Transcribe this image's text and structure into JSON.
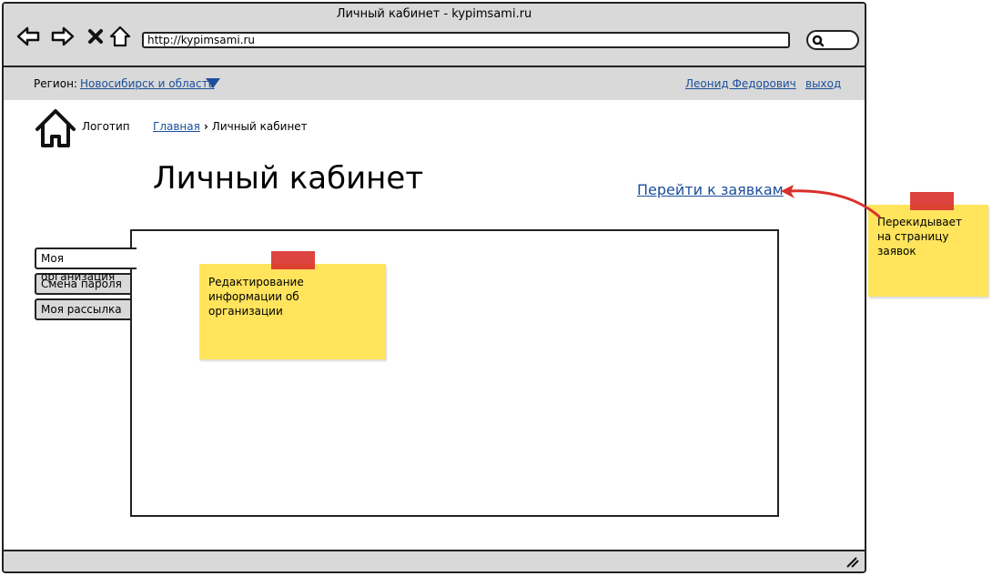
{
  "window": {
    "title": "Личный кабинет - kypimsami.ru",
    "url": "http://kypimsami.ru"
  },
  "region": {
    "label": "Регион:",
    "value": "Новосибирск и область"
  },
  "user": {
    "name": "Леонид Федорович",
    "logout": "выход"
  },
  "logo": {
    "text": "Логотип"
  },
  "breadcrumb": {
    "home": "Главная",
    "current": "Личный кабинет"
  },
  "page": {
    "title": "Личный кабинет",
    "orders_link": "Перейти к заявкам"
  },
  "tabs": [
    {
      "label": "Моя организация",
      "active": true
    },
    {
      "label": "Смена пароля",
      "active": false
    },
    {
      "label": "Моя рассылка",
      "active": false
    }
  ],
  "notes": {
    "org": "Редактирование информации об организации",
    "orders": "Перекидывает на страницу заявок"
  },
  "colors": {
    "link": "#1b4f9c",
    "sticky": "#ffe45c",
    "tape": "#d9302b",
    "chrome": "#d9d9d9"
  },
  "icons": [
    "back-icon",
    "forward-icon",
    "stop-icon",
    "home-icon",
    "search-icon",
    "house-logo-icon",
    "chevron-right-icon",
    "resize-grip-icon"
  ]
}
